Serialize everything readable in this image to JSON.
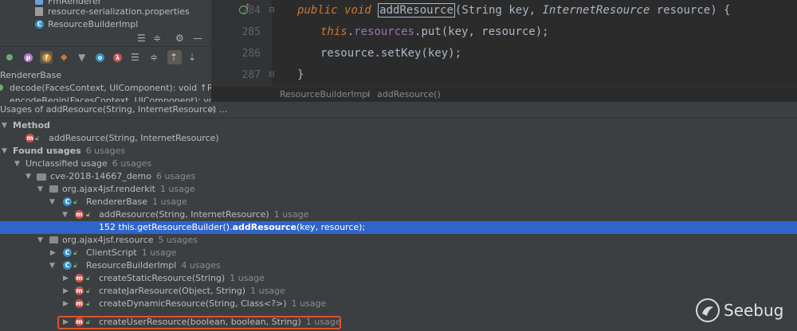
{
  "project": {
    "files": [
      "FmRenderer",
      "resource-serialization.properties",
      "ResourceBuilderImpl"
    ]
  },
  "structure": {
    "title": "RendererBase",
    "items": [
      "decode(FacesContext, UIComponent): void ↑R",
      "encodeBegin(FacesContext, UIComponent): vo"
    ]
  },
  "editor": {
    "line_numbers": [
      "284",
      "285",
      "286",
      "287"
    ],
    "line1": {
      "kw1": "public",
      "kw2": "void",
      "method": "addResource",
      "open": "(",
      "t1": "String",
      "p1": " key, ",
      "t2": "InternetResource",
      "p2": " resource) {"
    },
    "line2": {
      "this": "this",
      "rest1": ".",
      "field": "resources",
      "rest2": ".put(key, resource);"
    },
    "line3": {
      "text": "resource.setKey(key);"
    },
    "line4": {
      "text": "}"
    },
    "breadcrumb": [
      "ResourceBuilderImpl",
      "addResource()"
    ]
  },
  "find": {
    "header": "Usages of addResource(String, InternetResource) ...",
    "rows": [
      {
        "label": "Method",
        "count": ""
      },
      {
        "label": "addResource(String, InternetResource)",
        "count": ""
      },
      {
        "label": "Found usages",
        "count": "6 usages"
      },
      {
        "label": "Unclassified usage",
        "count": "6 usages"
      },
      {
        "label": "cve-2018-14667_demo",
        "count": "6 usages"
      },
      {
        "label": "org.ajax4jsf.renderkit",
        "count": "1 usage"
      },
      {
        "label": "RendererBase",
        "count": "1 usage"
      },
      {
        "label": "addResource(String, InternetResource)",
        "count": "1 usage"
      },
      {
        "label_num": "152",
        "label_pre": "this.getResourceBuilder().",
        "label_bold": "addResource",
        "label_post": "(key, resource);"
      },
      {
        "label": "org.ajax4jsf.resource",
        "count": "5 usages"
      },
      {
        "label": "ClientScript",
        "count": "1 usage"
      },
      {
        "label": "ResourceBuilderImpl",
        "count": "4 usages"
      },
      {
        "label": "createStaticResource(String)",
        "count": "1 usage"
      },
      {
        "label": "createJarResource(Object, String)",
        "count": "1 usage"
      },
      {
        "label": "createDynamicResource(String, Class<?>)",
        "count": "1 usage"
      },
      {
        "label": "createUserResource(boolean, boolean, String)",
        "count": "1 usage"
      }
    ]
  },
  "watermark": {
    "text": "Seebug"
  },
  "colors": {
    "selection": "#2f65ca",
    "highlight_box": "#e0522a",
    "keyword": "#cc7832",
    "field": "#9876aa"
  }
}
